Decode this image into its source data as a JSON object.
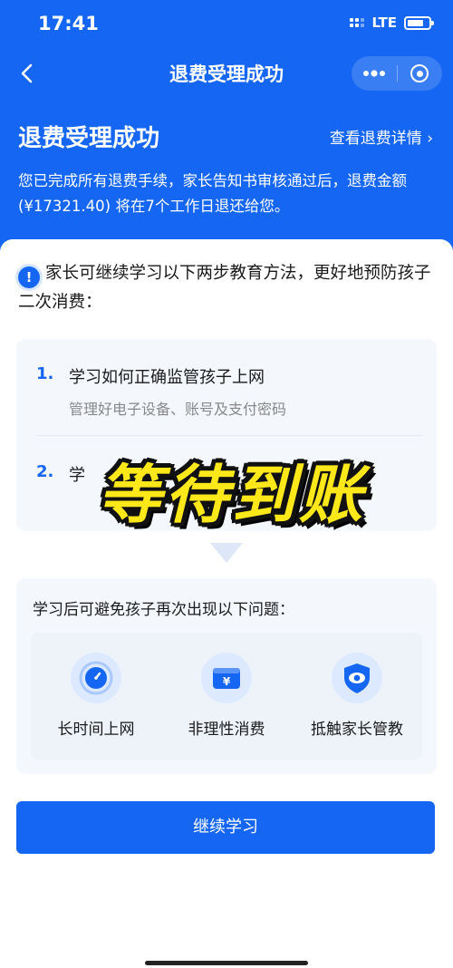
{
  "status_bar": {
    "time": "17:41",
    "network": "LTE"
  },
  "nav": {
    "title": "退费受理成功",
    "more_icon": "more-dots-icon",
    "close_icon": "capsule-close-icon"
  },
  "header": {
    "title": "退费受理成功",
    "detail_link": "查看退费详情 ›",
    "description": "您已完成所有退费手续，家长告知书审核通过后，退费金额 (¥17321.40) 将在7个工作日退还给您。"
  },
  "notice": {
    "text": "家长可继续学习以下两步教育方法，更好地预防孩子二次消费："
  },
  "steps": [
    {
      "num": "1.",
      "title": "学习如何正确监管孩子上网",
      "subtitle": "管理好电子设备、账号及支付密码"
    },
    {
      "num": "2.",
      "title": "学",
      "subtitle": ""
    }
  ],
  "overlay": {
    "text": "等待到账"
  },
  "problems": {
    "title": "学习后可避免孩子再次出现以下问题：",
    "items": [
      {
        "label": "长时间上网",
        "icon": "clock-icon"
      },
      {
        "label": "非理性消费",
        "icon": "wallet-yuan-icon"
      },
      {
        "label": "抵触家长管教",
        "icon": "shield-eye-icon"
      }
    ]
  },
  "actions": {
    "continue_label": "继续学习"
  },
  "colors": {
    "primary": "#1566f2",
    "overlay_yellow": "#ffe81a"
  }
}
